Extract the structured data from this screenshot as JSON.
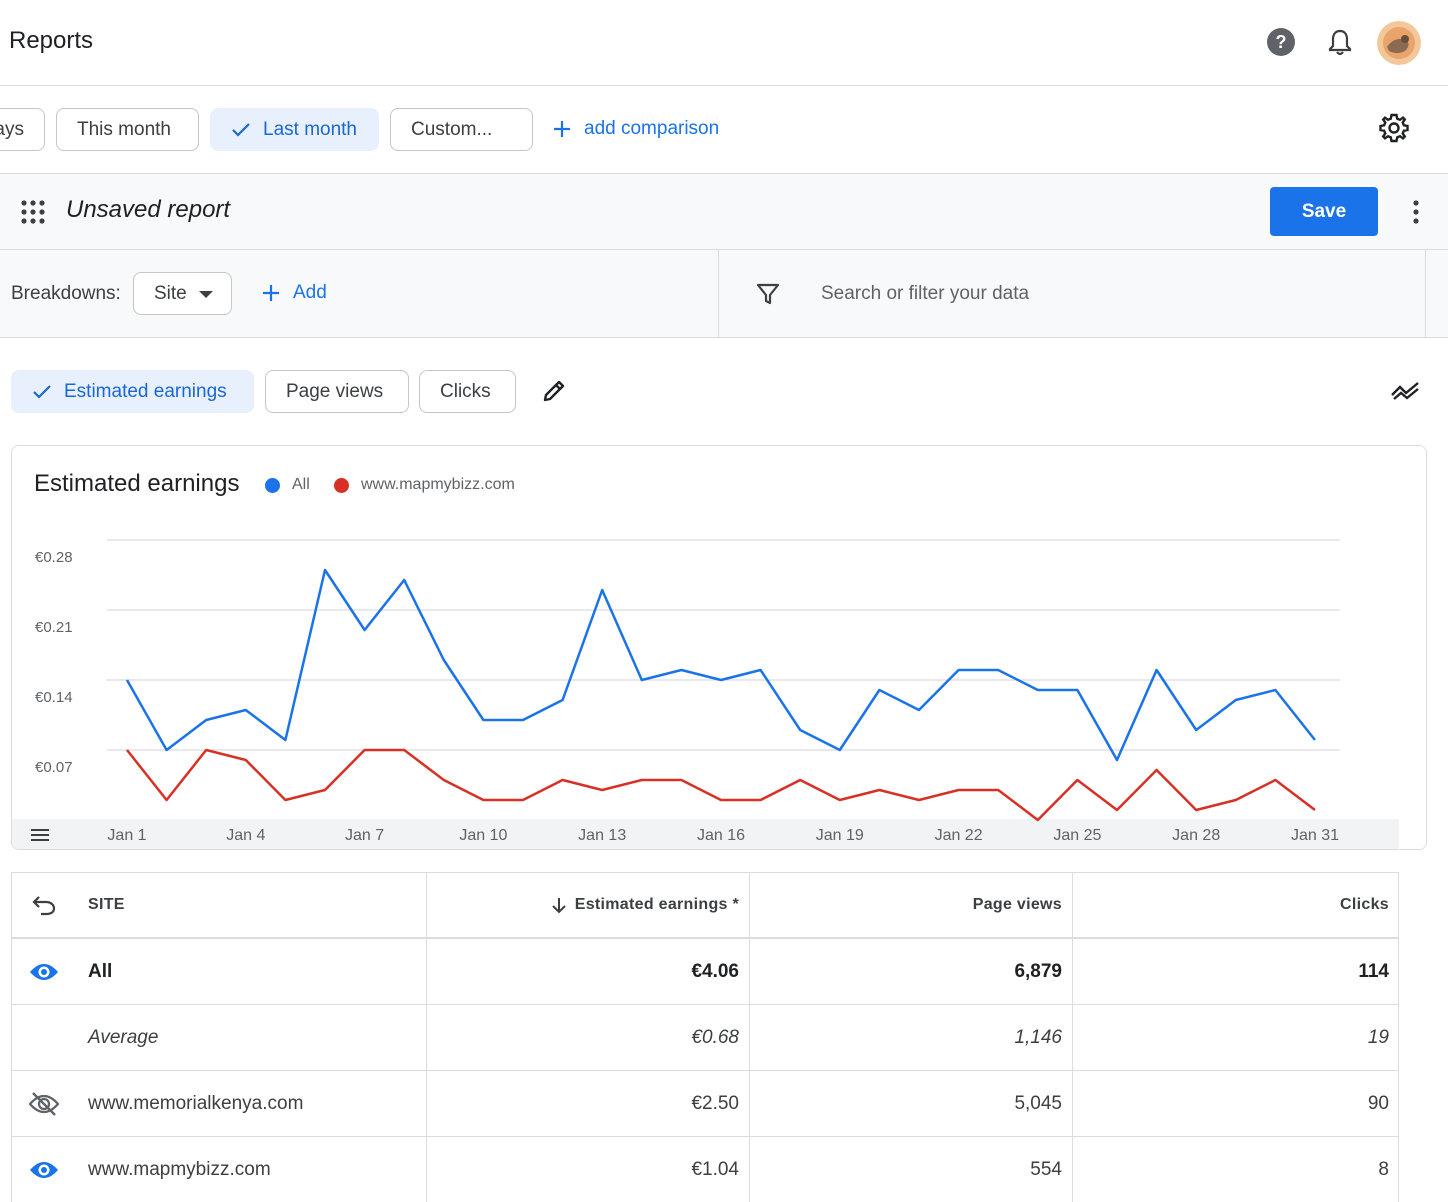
{
  "header": {
    "title": "Reports"
  },
  "date_range": {
    "chips": [
      {
        "label": "ays",
        "selected": false
      },
      {
        "label": "This month",
        "selected": false
      },
      {
        "label": "Last month",
        "selected": true
      },
      {
        "label": "Custom...",
        "selected": false
      }
    ],
    "add_comparison_label": "add comparison"
  },
  "report": {
    "title": "Unsaved report",
    "save_label": "Save"
  },
  "breakdowns": {
    "label": "Breakdowns:",
    "selected": "Site",
    "add_label": "Add",
    "filter_placeholder": "Search or filter your data"
  },
  "metrics": [
    {
      "label": "Estimated earnings",
      "selected": true
    },
    {
      "label": "Page views",
      "selected": false
    },
    {
      "label": "Clicks",
      "selected": false
    }
  ],
  "colors": {
    "accent": "#1a73e8",
    "series_all": "#1a73e8",
    "series_site": "#d93025"
  },
  "chart_data": {
    "type": "line",
    "title": "Estimated earnings",
    "x": [
      "Jan 1",
      "Jan 2",
      "Jan 3",
      "Jan 4",
      "Jan 5",
      "Jan 6",
      "Jan 7",
      "Jan 8",
      "Jan 9",
      "Jan 10",
      "Jan 11",
      "Jan 12",
      "Jan 13",
      "Jan 14",
      "Jan 15",
      "Jan 16",
      "Jan 17",
      "Jan 18",
      "Jan 19",
      "Jan 20",
      "Jan 21",
      "Jan 22",
      "Jan 23",
      "Jan 24",
      "Jan 25",
      "Jan 26",
      "Jan 27",
      "Jan 28",
      "Jan 29",
      "Jan 30",
      "Jan 31"
    ],
    "x_tick_labels": [
      "Jan 1",
      "Jan 4",
      "Jan 7",
      "Jan 10",
      "Jan 13",
      "Jan 16",
      "Jan 19",
      "Jan 22",
      "Jan 25",
      "Jan 28",
      "Jan 31"
    ],
    "y_tick_labels": [
      "€0.28",
      "€0.21",
      "€0.14",
      "€0.07"
    ],
    "y_ticks": [
      0.28,
      0.21,
      0.14,
      0.07
    ],
    "ylim": [
      0,
      0.28
    ],
    "grid": true,
    "legend_position": "top-left",
    "series": [
      {
        "name": "All",
        "values": [
          0.14,
          0.07,
          0.1,
          0.11,
          0.08,
          0.25,
          0.19,
          0.24,
          0.16,
          0.1,
          0.1,
          0.12,
          0.23,
          0.14,
          0.15,
          0.14,
          0.15,
          0.09,
          0.07,
          0.13,
          0.11,
          0.15,
          0.15,
          0.13,
          0.13,
          0.06,
          0.15,
          0.09,
          0.12,
          0.13,
          0.08
        ]
      },
      {
        "name": "www.mapmybizz.com",
        "values": [
          0.07,
          0.02,
          0.07,
          0.06,
          0.02,
          0.03,
          0.07,
          0.07,
          0.04,
          0.02,
          0.02,
          0.04,
          0.03,
          0.04,
          0.04,
          0.02,
          0.02,
          0.04,
          0.02,
          0.03,
          0.02,
          0.03,
          0.03,
          0.0,
          0.04,
          0.01,
          0.05,
          0.01,
          0.02,
          0.04,
          0.01
        ]
      }
    ]
  },
  "table": {
    "headers": {
      "site": "SITE",
      "earnings": "Estimated earnings *",
      "page_views": "Page views",
      "clicks": "Clicks"
    },
    "rows": [
      {
        "site": "All",
        "earnings": "€4.06",
        "page_views": "6,879",
        "clicks": "114"
      },
      {
        "site": "Average",
        "earnings": "€0.68",
        "page_views": "1,146",
        "clicks": "19"
      },
      {
        "site": "www.memorialkenya.com",
        "earnings": "€2.50",
        "page_views": "5,045",
        "clicks": "90"
      },
      {
        "site": "www.mapmybizz.com",
        "earnings": "€1.04",
        "page_views": "554",
        "clicks": "8"
      }
    ]
  }
}
